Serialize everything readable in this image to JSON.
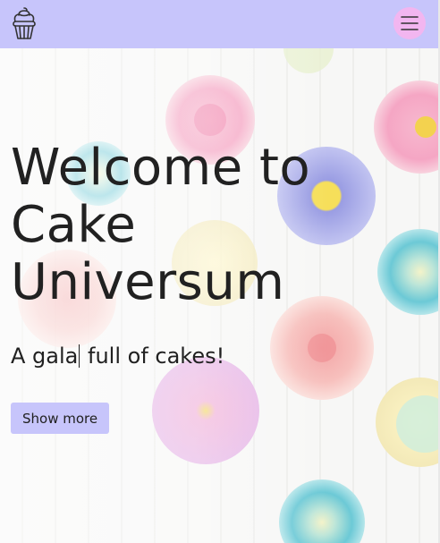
{
  "header": {
    "logo_icon": "cupcake-icon",
    "menu_icon": "hamburger-menu-icon",
    "bar_color": "#c7c5fb",
    "menu_button_color": "#f2b6f0"
  },
  "hero": {
    "title_line1": "Welcome to",
    "title_line2": "Cake",
    "title_line3": "Universum",
    "subtitle_before_cursor": "A gala",
    "subtitle_after_cursor": " full of cakes!",
    "button_label": "Show more",
    "button_color": "#c7c5fb"
  }
}
